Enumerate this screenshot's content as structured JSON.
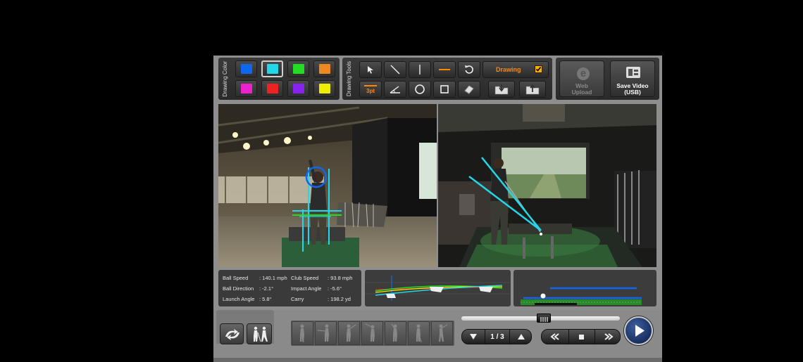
{
  "drawing_color": {
    "label": "Drawing Color",
    "swatches": [
      {
        "name": "blue",
        "color": "#1166ee"
      },
      {
        "name": "cyan",
        "color": "#22d8e8",
        "selected": true
      },
      {
        "name": "green",
        "color": "#22dd22"
      },
      {
        "name": "orange",
        "color": "#ee8822"
      },
      {
        "name": "magenta",
        "color": "#ee22cc"
      },
      {
        "name": "red",
        "color": "#ee2222"
      },
      {
        "name": "purple",
        "color": "#8822ee"
      },
      {
        "name": "yellow",
        "color": "#eeee00"
      }
    ]
  },
  "drawing_tools": {
    "label": "Drawing Tools",
    "tools": [
      "pointer",
      "diagonal-line",
      "vertical-line",
      "horizontal-line",
      "undo",
      "line-weight",
      "angle",
      "circle",
      "rectangle",
      "eraser",
      "save-drawing",
      "load-drawing"
    ],
    "line_weight_label": "3pt",
    "drawing_toggle_label": "Drawing",
    "drawing_enabled": true
  },
  "actions": {
    "web_upload_label": "Web\nUpload",
    "save_video_label": "Save Video\n(USB)"
  },
  "stats": [
    {
      "label": "Ball Speed",
      "value": ": 140.1 mph"
    },
    {
      "label": "Club Speed",
      "value": ": 93.8 mph"
    },
    {
      "label": "Ball Direction",
      "value": ": -2.1°"
    },
    {
      "label": "Impact Angle",
      "value": ": -5.6°"
    },
    {
      "label": "Launch Angle",
      "value": ": 5.8°"
    },
    {
      "label": "Carry",
      "value": ": 198.2 yd"
    }
  ],
  "playback": {
    "page_indicator": "1 / 3",
    "progress": 0.52
  },
  "colors": {
    "accent_orange": "#ff8800",
    "overlay_cyan": "#22d8e8",
    "play_blue": "#1f3f80"
  }
}
